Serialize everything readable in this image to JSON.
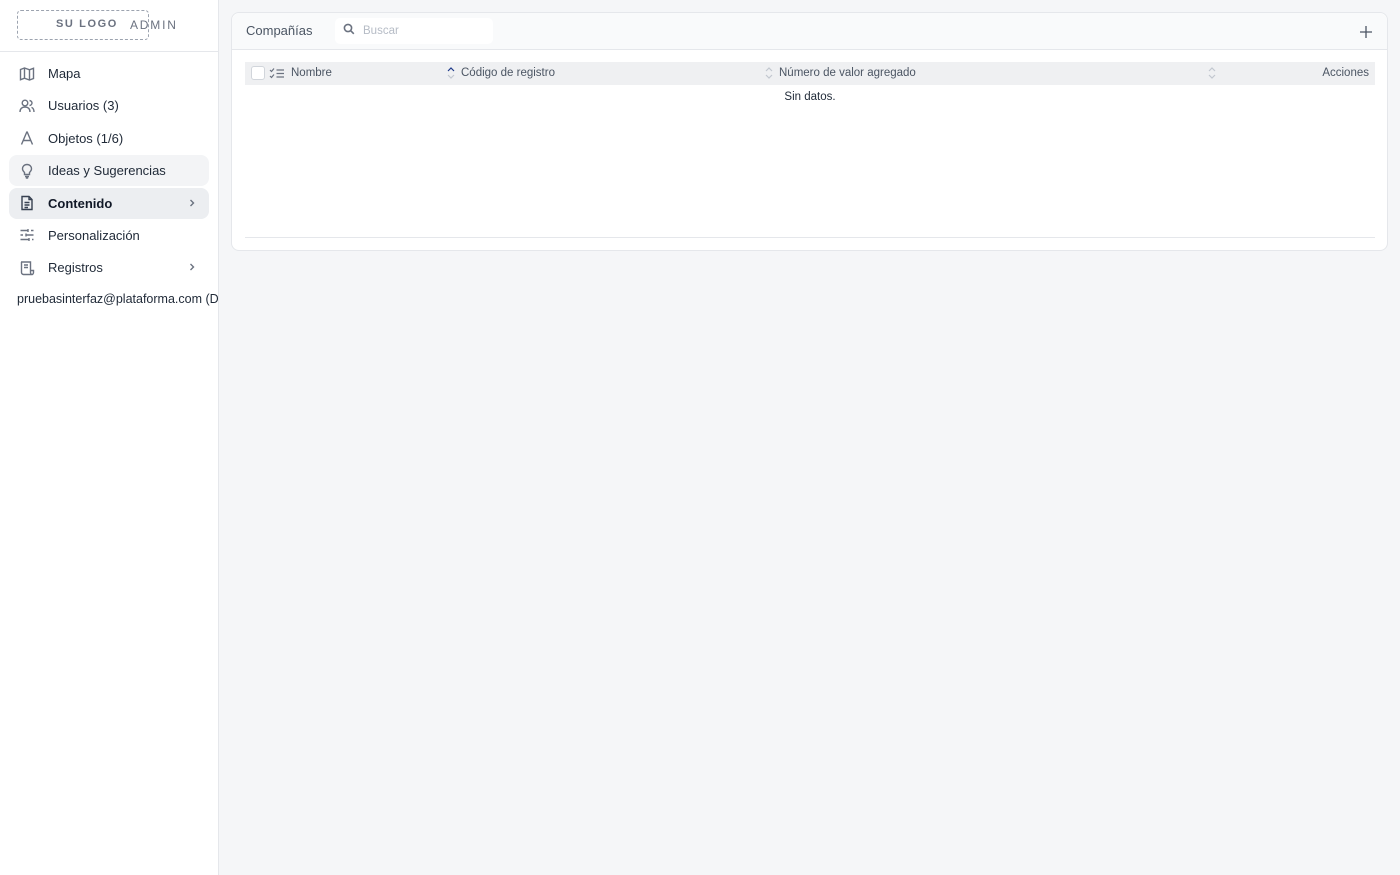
{
  "sidebar": {
    "logo_text": "SU LOGO",
    "admin_label": "ADMIN",
    "items": [
      {
        "label": "Mapa",
        "icon": "map-icon"
      },
      {
        "label": "Usuarios (3)",
        "icon": "users-icon"
      },
      {
        "label": "Objetos (1/6)",
        "icon": "objects-icon"
      },
      {
        "label": "Ideas y Sugerencias",
        "icon": "lightbulb-icon"
      },
      {
        "label": "Contenido",
        "icon": "document-icon"
      },
      {
        "label": "Personalización",
        "icon": "sliders-icon"
      },
      {
        "label": "Registros",
        "icon": "scroll-icon"
      }
    ],
    "user_email": "pruebasinterfaz@plataforma.com (D"
  },
  "main": {
    "title": "Compañías",
    "search": {
      "placeholder": "Buscar",
      "value": ""
    },
    "table": {
      "columns": [
        "Nombre",
        "Código de registro",
        "Número de valor agregado",
        "Acciones"
      ],
      "empty_text": "Sin datos."
    }
  },
  "colors": {
    "sidebar_bg": "#ffffff",
    "page_bg": "#f5f6f8",
    "active_item_bg": "#eceef1",
    "sort_active": "#1e3a8a"
  }
}
